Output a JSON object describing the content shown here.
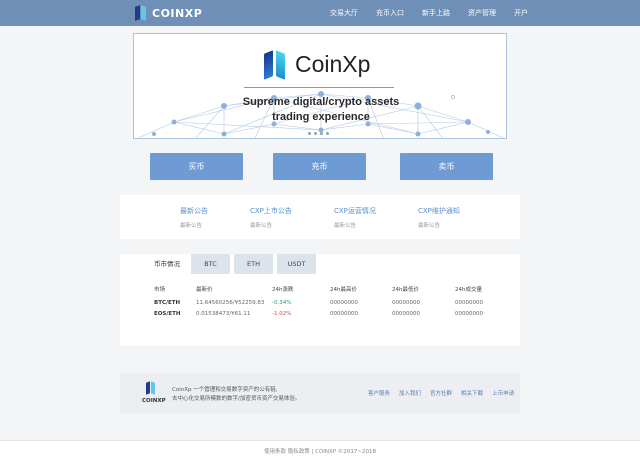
{
  "header": {
    "logo_text": "COINXP",
    "nav": [
      "交易大厅",
      "充币入口",
      "新手上路",
      "资产管理",
      "开户"
    ]
  },
  "banner": {
    "brand_name": "CoinXp",
    "slogan_line1": "Supreme digital/crypto assets",
    "slogan_line2": "trading experience",
    "slide_count": 4
  },
  "actions": {
    "buy_label": "买币",
    "deposit_label": "充币",
    "sell_label": "卖币"
  },
  "announcements": [
    {
      "title": "最新公告",
      "sub": "最新公告"
    },
    {
      "title": "CXP上市公告",
      "sub": "最新公告"
    },
    {
      "title": "CXP运营情况",
      "sub": "最新公告"
    },
    {
      "title": "CXP维护通知",
      "sub": "最新公告"
    }
  ],
  "market": {
    "tabs": [
      "币市情况",
      "BTC",
      "ETH",
      "USDT"
    ],
    "active_tab": "币市情况",
    "columns": [
      "市场",
      "最新价",
      "24h涨跌",
      "24h最高价",
      "24h最低价",
      "24h成交量"
    ],
    "rows": [
      {
        "market": "BTC/ETH",
        "price": "11.64560256/¥52259.83",
        "change": "-0.34%",
        "high": "00000000",
        "low": "00000000",
        "volume": "00000000"
      },
      {
        "market": "EOS/ETH",
        "price": "0.01538473/¥61.11",
        "change": "-1.02%",
        "high": "00000000",
        "low": "00000000",
        "volume": "00000000"
      }
    ]
  },
  "footer": {
    "brand": "COINXP",
    "desc_line1": "CoinXp 一个管理和交易数字资产的公有链,",
    "desc_line2": "去中心化交易所模数的数字/加密货币资产交易体验。",
    "links": [
      "客户服务",
      "加入我们",
      "官方社群",
      "相关下载",
      "上币申请"
    ]
  },
  "copyright": {
    "text": "使用条款  隐私政策 | COINXP ©2017~2018"
  },
  "colors": {
    "topbar": "#6f8fb7",
    "button": "#6f9bd4",
    "link": "#5b8fd0",
    "up": "#2aa371",
    "down": "#d54d4d"
  }
}
